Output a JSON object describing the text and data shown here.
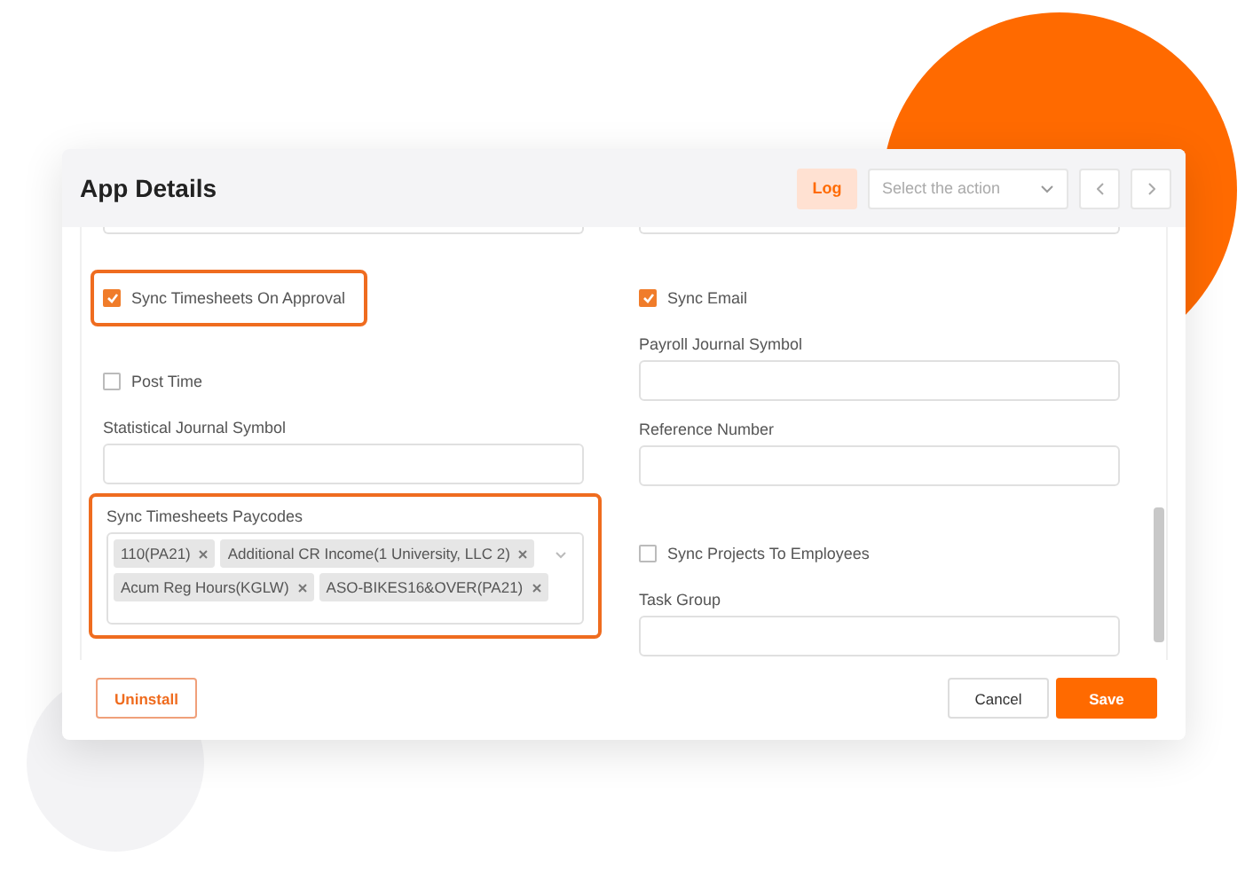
{
  "header": {
    "title": "App Details",
    "log_button": "Log",
    "action_select": {
      "placeholder": "Select the action"
    }
  },
  "form": {
    "left": [
      {
        "kind": "partial"
      },
      {
        "kind": "checkbox",
        "label": "Sync Timesheets On Approval",
        "checked": true,
        "highlighted": true
      },
      {
        "kind": "checkbox",
        "label": "Post Time",
        "checked": false,
        "highlighted": false
      },
      {
        "kind": "field",
        "label": "Statistical Journal Symbol",
        "highlighted": false
      },
      {
        "kind": "multiselect",
        "label": "Sync Timesheets Paycodes",
        "highlighted": true,
        "tags": [
          "110(PA21)",
          "Additional CR Income(1 University, LLC 2)",
          "Acum Reg Hours(KGLW)",
          "ASO-BIKES16&OVER(PA21)"
        ]
      }
    ],
    "right": [
      {
        "kind": "partial"
      },
      {
        "kind": "checkbox",
        "label": "Sync Email",
        "checked": true,
        "highlighted": false
      },
      {
        "kind": "field",
        "label": "Payroll Journal Symbol",
        "highlighted": false
      },
      {
        "kind": "field",
        "label": "Reference Number",
        "highlighted": false
      },
      {
        "kind": "checkbox",
        "label": "Sync Projects To Employees",
        "checked": false,
        "highlighted": false
      },
      {
        "kind": "field",
        "label": "Task Group",
        "highlighted": false
      }
    ]
  },
  "footer": {
    "uninstall": "Uninstall",
    "cancel": "Cancel",
    "save": "Save"
  }
}
